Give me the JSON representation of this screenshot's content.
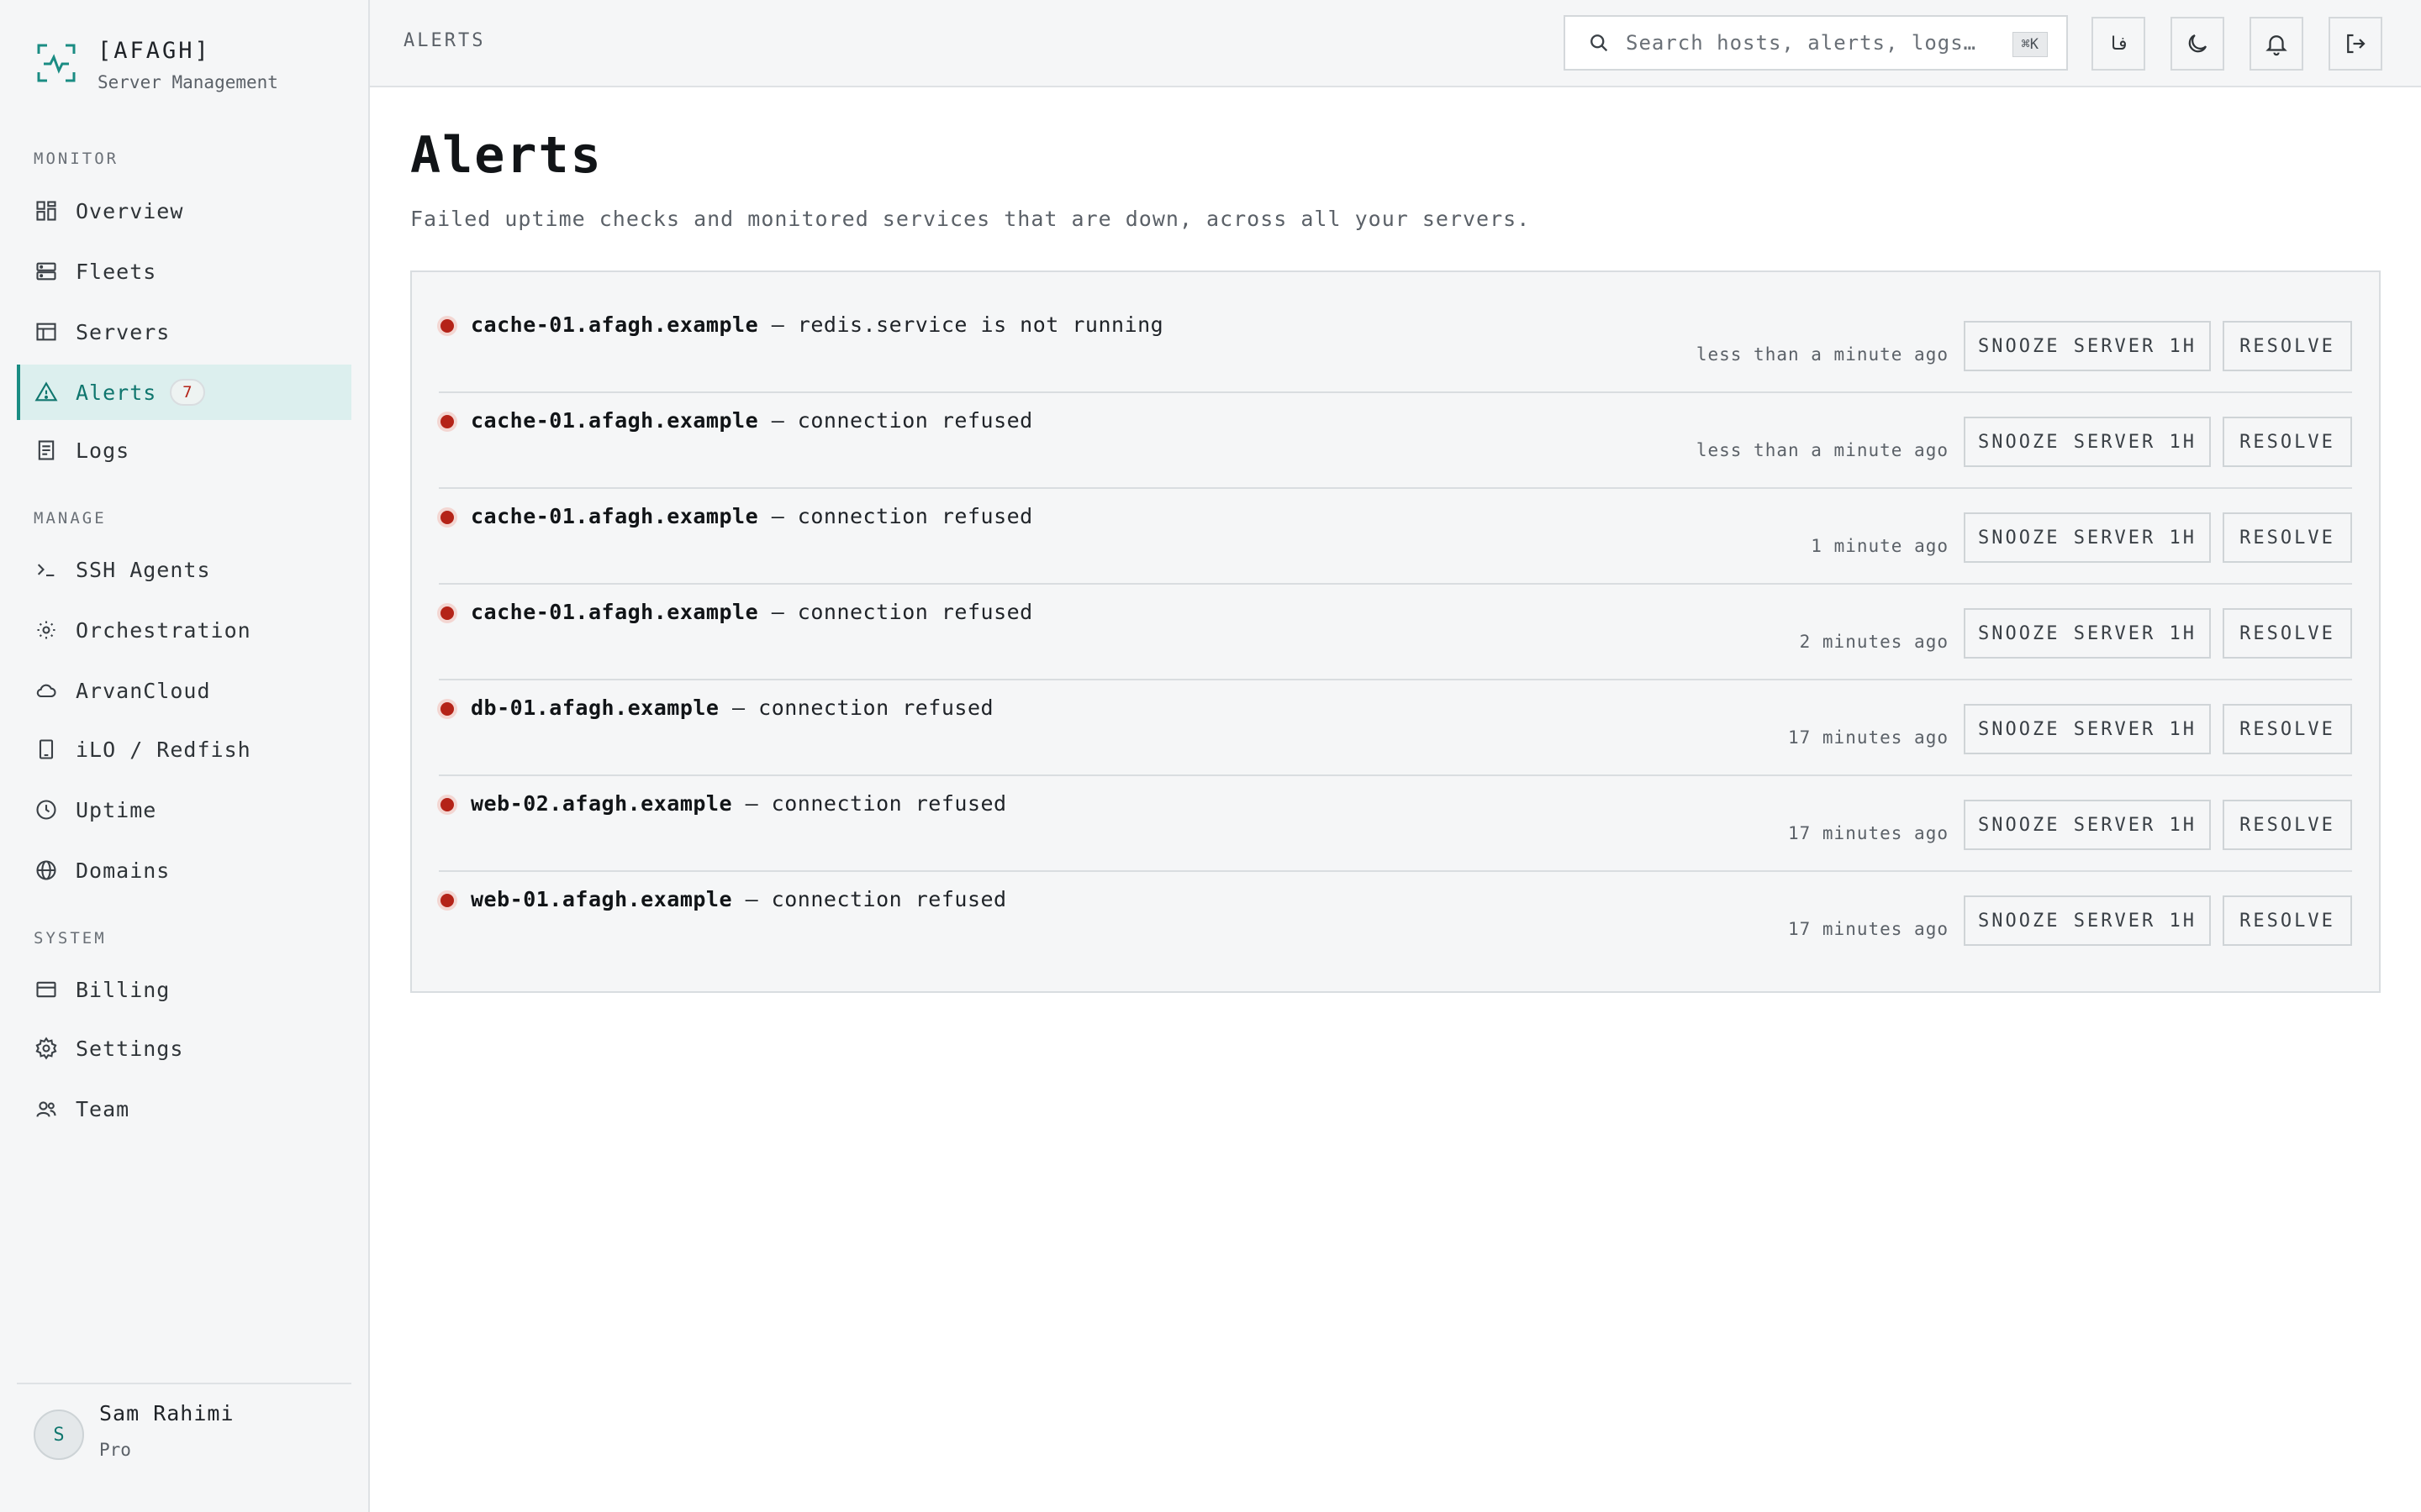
{
  "brand": {
    "name": "[AFAGH]",
    "subtitle": "Server Management",
    "accent": "#1a8c83"
  },
  "sidebar": {
    "sections": [
      {
        "label": "MONITOR"
      },
      {
        "label": "MANAGE"
      },
      {
        "label": "SYSTEM"
      }
    ],
    "items": [
      {
        "label": "Overview",
        "icon": "grid-icon"
      },
      {
        "label": "Fleets",
        "icon": "server-stack-icon"
      },
      {
        "label": "Servers",
        "icon": "table-icon"
      },
      {
        "label": "Alerts",
        "icon": "warning-triangle-icon",
        "badge": "7",
        "active": true
      },
      {
        "label": "Logs",
        "icon": "document-icon"
      },
      {
        "label": "SSH Agents",
        "icon": "terminal-icon"
      },
      {
        "label": "Orchestration",
        "icon": "sun-gear-icon"
      },
      {
        "label": "ArvanCloud",
        "icon": "cloud-icon"
      },
      {
        "label": "iLO / Redfish",
        "icon": "device-icon"
      },
      {
        "label": "Uptime",
        "icon": "clock-icon"
      },
      {
        "label": "Domains",
        "icon": "globe-icon"
      },
      {
        "label": "Billing",
        "icon": "credit-card-icon"
      },
      {
        "label": "Settings",
        "icon": "gear-icon"
      },
      {
        "label": "Team",
        "icon": "users-icon"
      }
    ]
  },
  "user": {
    "initial": "S",
    "name": "Sam Rahimi",
    "plan": "Pro"
  },
  "topbar": {
    "breadcrumb": "ALERTS",
    "search_placeholder": "Search hosts, alerts, logs…",
    "search_shortcut": "⌘K",
    "language_toggle": "فا",
    "icons": [
      "theme-moon-icon",
      "bell-icon",
      "logout-icon"
    ]
  },
  "main": {
    "title": "Alerts",
    "description": "Failed uptime checks and monitored services that are down, across all your servers.",
    "snooze_label": "SNOOZE SERVER 1H",
    "resolve_label": "RESOLVE",
    "alerts": [
      {
        "host": "cache-01.afagh.example",
        "message": " — redis.service is not running",
        "time": "less than a minute ago"
      },
      {
        "host": "cache-01.afagh.example",
        "message": " — connection refused",
        "time": "less than a minute ago"
      },
      {
        "host": "cache-01.afagh.example",
        "message": " — connection refused",
        "time": "1 minute ago"
      },
      {
        "host": "cache-01.afagh.example",
        "message": " — connection refused",
        "time": "2 minutes ago"
      },
      {
        "host": "db-01.afagh.example",
        "message": " — connection refused",
        "time": "17 minutes ago"
      },
      {
        "host": "web-02.afagh.example",
        "message": " — connection refused",
        "time": "17 minutes ago"
      },
      {
        "host": "web-01.afagh.example",
        "message": " — connection refused",
        "time": "17 minutes ago"
      }
    ],
    "status_color": "#b42318"
  }
}
